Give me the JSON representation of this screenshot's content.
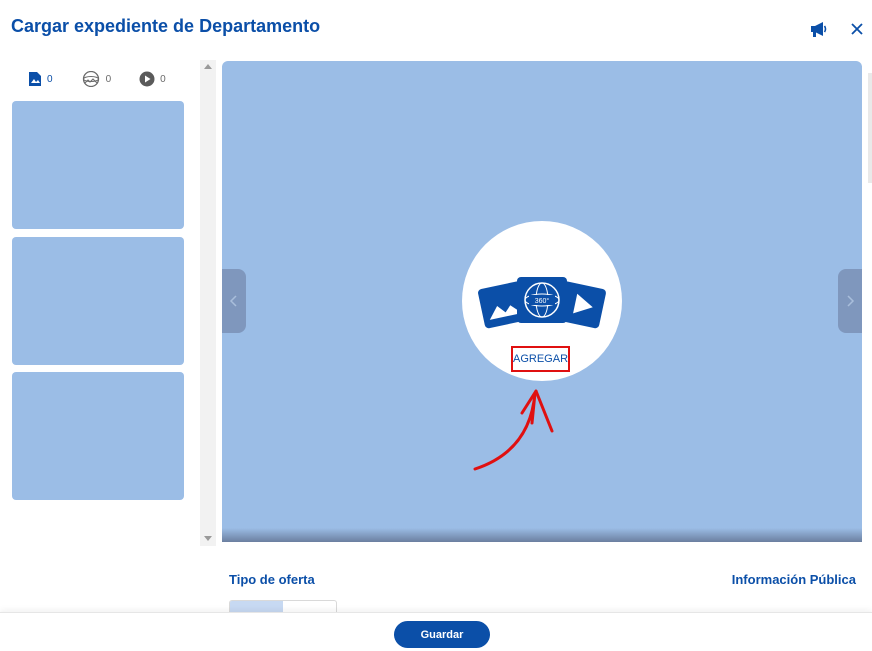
{
  "header": {
    "title": "Cargar expediente de Departamento",
    "icons": [
      "megaphone-icon",
      "close-icon"
    ]
  },
  "media_counters": [
    {
      "icon": "photo-icon",
      "count": "0",
      "active": true
    },
    {
      "icon": "panorama-360-icon",
      "count": "0",
      "active": false
    },
    {
      "icon": "video-play-icon",
      "count": "0",
      "active": false
    }
  ],
  "viewer": {
    "add_label": "AGREGAR",
    "graphic_badge": "360°"
  },
  "form": {
    "offer_type_label": "Tipo de oferta",
    "public_info_label": "Información Pública"
  },
  "footer": {
    "save_label": "Guardar"
  },
  "colors": {
    "primary": "#0b4fa8",
    "placeholder": "#9bbde6",
    "highlight": "#e01010"
  }
}
